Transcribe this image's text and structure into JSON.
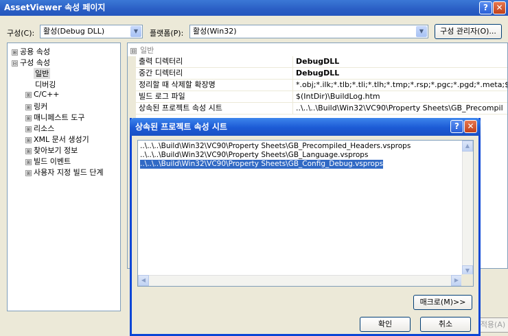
{
  "window": {
    "title": "AssetViewer 속성 페이지",
    "help_glyph": "?",
    "close_glyph": "✕"
  },
  "config_row": {
    "config_label": "구성(C):",
    "config_value": "활성(Debug DLL)",
    "platform_label": "플랫폼(P):",
    "platform_value": "활성(Win32)",
    "config_manager_label": "구성 관리자(O)..."
  },
  "tree": {
    "items": [
      {
        "label": "공용 속성",
        "exp": "⊞"
      },
      {
        "label": "구성 속성",
        "exp": "⊟"
      },
      {
        "label": "일반"
      },
      {
        "label": "디버깅"
      },
      {
        "label": "C/C++",
        "exp": "⊞"
      },
      {
        "label": "링커",
        "exp": "⊞"
      },
      {
        "label": "매니페스트 도구",
        "exp": "⊞"
      },
      {
        "label": "리소스",
        "exp": "⊞"
      },
      {
        "label": "XML 문서 생성기",
        "exp": "⊞"
      },
      {
        "label": "찾아보기 정보",
        "exp": "⊞"
      },
      {
        "label": "빌드 이벤트",
        "exp": "⊞"
      },
      {
        "label": "사용자 지정 빌드 단계",
        "exp": "⊞"
      }
    ]
  },
  "grid": {
    "category": "일반",
    "category_exp": "⊟",
    "rows": [
      {
        "name": "출력 디렉터리",
        "value": "DebugDLL"
      },
      {
        "name": "중간 디렉터리",
        "value": "DebugDLL"
      },
      {
        "name": "정리할 때 삭제할 확장명",
        "value": "*.obj;*.ilk;*.tlb;*.tli;*.tlh;*.tmp;*.rsp;*.pgc;*.pgd;*.meta;$(TargetPat"
      },
      {
        "name": "빌드 로그 파일",
        "value": "$(IntDir)\\BuildLog.htm"
      },
      {
        "name": "상속된 프로젝트 속성 시트",
        "value": "..\\..\\..\\Build\\Win32\\VC90\\Property Sheets\\GB_Precompil"
      }
    ]
  },
  "apply_label": "적용(A)",
  "dialog": {
    "title": "상속된 프로젝트 속성 시트",
    "items": [
      "..\\..\\..\\Build\\Win32\\VC90\\Property Sheets\\GB_Precompiled_Headers.vsprops",
      "..\\..\\..\\Build\\Win32\\VC90\\Property Sheets\\GB_Language.vsprops",
      "..\\..\\..\\Build\\Win32\\VC90\\Property Sheets\\GB_Config_Debug.vsprops"
    ],
    "selected_index": 2,
    "macro_label": "매크로(M)>>",
    "ok_label": "확인",
    "cancel_label": "취소"
  },
  "colors": {
    "title_blue": "#2a5ec4",
    "selection": "#316ac5",
    "dialog_border": "#0a46d6"
  }
}
